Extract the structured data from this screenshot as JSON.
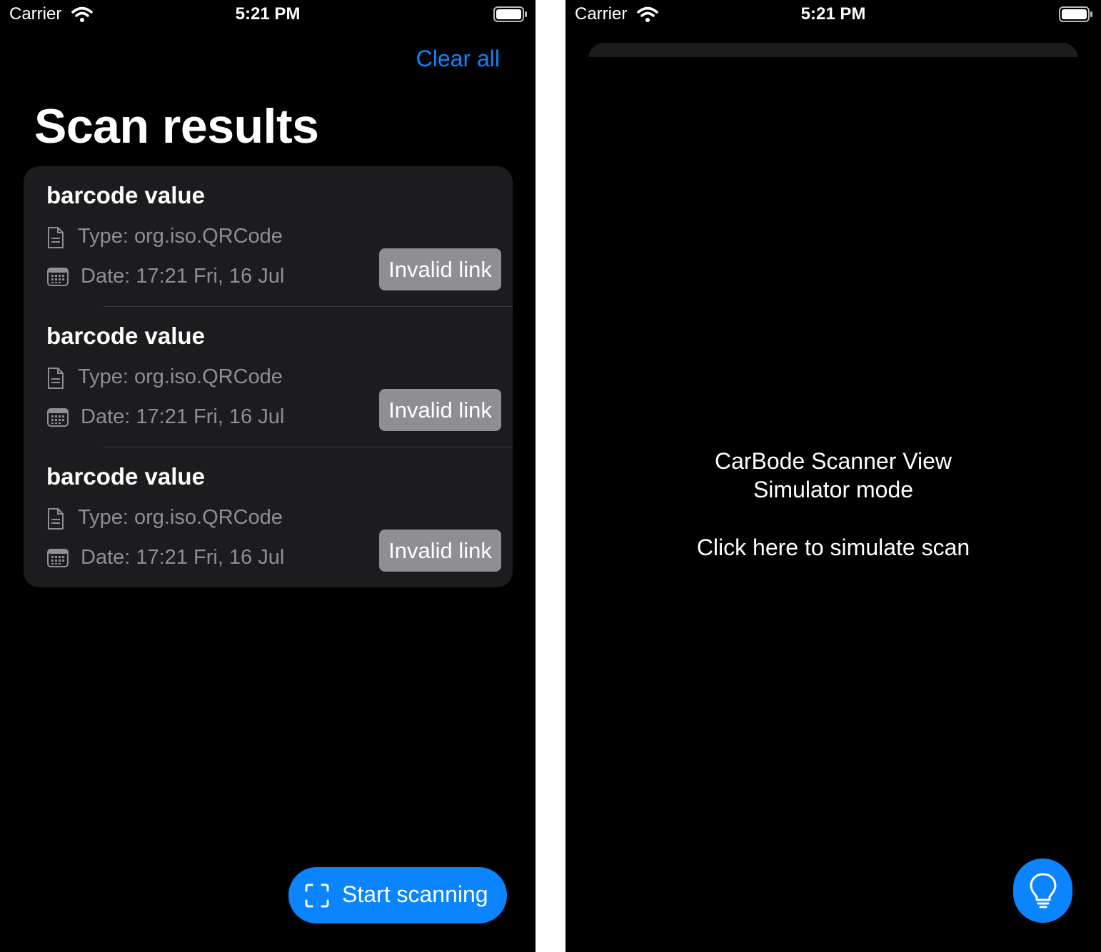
{
  "status_bar": {
    "carrier": "Carrier",
    "time": "5:21 PM"
  },
  "left": {
    "clear_all": "Clear all",
    "title": "Scan results",
    "results": [
      {
        "title": "barcode value",
        "type": "Type: org.iso.QRCode",
        "date": "Date: 17:21 Fri, 16 Jul",
        "badge": "Invalid link"
      },
      {
        "title": "barcode value",
        "type": "Type: org.iso.QRCode",
        "date": "Date: 17:21 Fri, 16 Jul",
        "badge": "Invalid link"
      },
      {
        "title": "barcode value",
        "type": "Type: org.iso.QRCode",
        "date": "Date: 17:21 Fri, 16 Jul",
        "badge": "Invalid link"
      }
    ],
    "start_scanning": "Start scanning"
  },
  "right": {
    "line1": "CarBode Scanner View",
    "line2": "Simulator mode",
    "line3": "Click here to simulate scan"
  },
  "icons": {
    "wifi": "wifi-icon",
    "battery": "battery-icon",
    "document": "document-icon",
    "calendar": "calendar-icon",
    "scan": "scan-frame-icon",
    "bulb": "lightbulb-icon"
  },
  "colors": {
    "accent": "#0a84ff",
    "card": "#1c1c1e",
    "badge": "#8e8e93",
    "secondary_text": "#8e8e93"
  }
}
